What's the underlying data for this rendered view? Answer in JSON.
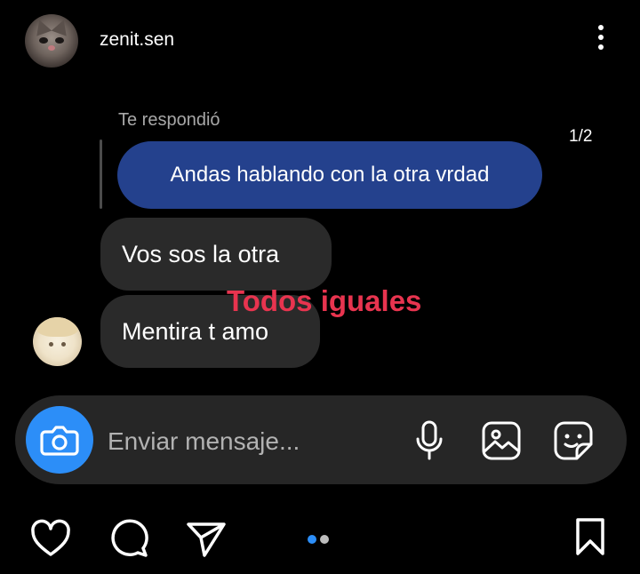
{
  "header": {
    "username": "zenit.sen"
  },
  "story": {
    "counter": "1/2"
  },
  "chat": {
    "reply_label": "Te respondió",
    "replied_message": "Andas hablando con la otra vrdad",
    "messages": [
      "Vos sos la otra",
      "Mentira t amo"
    ],
    "overlay_text": "Todos iguales"
  },
  "composer": {
    "placeholder": "Enviar mensaje..."
  },
  "colors": {
    "accent_blue": "#2c8ef8",
    "bubble_blue": "#24418d",
    "overlay_red": "#e8344f"
  },
  "icons": [
    "menu-dots-icon",
    "camera-icon",
    "microphone-icon",
    "gallery-icon",
    "sticker-icon",
    "heart-icon",
    "comment-icon",
    "share-icon",
    "bookmark-icon"
  ],
  "pagination": {
    "current": 1,
    "total": 2
  }
}
